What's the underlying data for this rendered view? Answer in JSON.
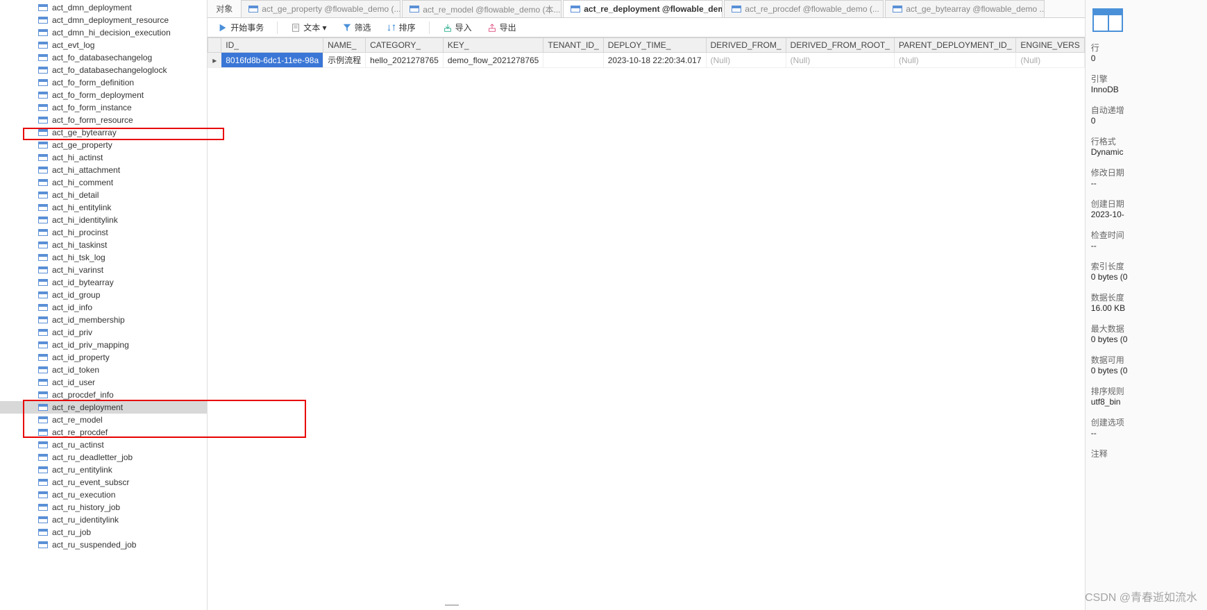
{
  "sidebar": {
    "items": [
      {
        "label": "act_dmn_deployment"
      },
      {
        "label": "act_dmn_deployment_resource"
      },
      {
        "label": "act_dmn_hi_decision_execution"
      },
      {
        "label": "act_evt_log"
      },
      {
        "label": "act_fo_databasechangelog"
      },
      {
        "label": "act_fo_databasechangeloglock"
      },
      {
        "label": "act_fo_form_definition"
      },
      {
        "label": "act_fo_form_deployment"
      },
      {
        "label": "act_fo_form_instance"
      },
      {
        "label": "act_fo_form_resource"
      },
      {
        "label": "act_ge_bytearray"
      },
      {
        "label": "act_ge_property"
      },
      {
        "label": "act_hi_actinst"
      },
      {
        "label": "act_hi_attachment"
      },
      {
        "label": "act_hi_comment"
      },
      {
        "label": "act_hi_detail"
      },
      {
        "label": "act_hi_entitylink"
      },
      {
        "label": "act_hi_identitylink"
      },
      {
        "label": "act_hi_procinst"
      },
      {
        "label": "act_hi_taskinst"
      },
      {
        "label": "act_hi_tsk_log"
      },
      {
        "label": "act_hi_varinst"
      },
      {
        "label": "act_id_bytearray"
      },
      {
        "label": "act_id_group"
      },
      {
        "label": "act_id_info"
      },
      {
        "label": "act_id_membership"
      },
      {
        "label": "act_id_priv"
      },
      {
        "label": "act_id_priv_mapping"
      },
      {
        "label": "act_id_property"
      },
      {
        "label": "act_id_token"
      },
      {
        "label": "act_id_user"
      },
      {
        "label": "act_procdef_info"
      },
      {
        "label": "act_re_deployment",
        "selected": true
      },
      {
        "label": "act_re_model"
      },
      {
        "label": "act_re_procdef"
      },
      {
        "label": "act_ru_actinst"
      },
      {
        "label": "act_ru_deadletter_job"
      },
      {
        "label": "act_ru_entitylink"
      },
      {
        "label": "act_ru_event_subscr"
      },
      {
        "label": "act_ru_execution"
      },
      {
        "label": "act_ru_history_job"
      },
      {
        "label": "act_ru_identitylink"
      },
      {
        "label": "act_ru_job"
      },
      {
        "label": "act_ru_suspended_job"
      }
    ]
  },
  "tabs": {
    "obj_label": "对象",
    "items": [
      {
        "label": "act_ge_property @flowable_demo (..."
      },
      {
        "label": "act_re_model @flowable_demo (本..."
      },
      {
        "label": "act_re_deployment @flowable_dem...",
        "active": true
      },
      {
        "label": "act_re_procdef @flowable_demo (..."
      },
      {
        "label": "act_ge_bytearray @flowable_demo ..."
      }
    ]
  },
  "toolbar": {
    "begin_tx": "开始事务",
    "text": "文本 ▾",
    "filter": "筛选",
    "sort": "排序",
    "import": "导入",
    "export": "导出"
  },
  "grid": {
    "columns": [
      "ID_",
      "NAME_",
      "CATEGORY_",
      "KEY_",
      "TENANT_ID_",
      "DEPLOY_TIME_",
      "DERIVED_FROM_",
      "DERIVED_FROM_ROOT_",
      "PARENT_DEPLOYMENT_ID_",
      "ENGINE_VERS"
    ],
    "row": {
      "id": "8016fd8b-6dc1-11ee-98a",
      "name": "示例流程",
      "category": "hello_2021278765",
      "key": "demo_flow_2021278765",
      "tenant": "",
      "deploy_time": "2023-10-18 22:20:34.017",
      "derived_from": "(Null)",
      "derived_from_root": "(Null)",
      "parent_deployment": "(Null)",
      "engine": "(Null)"
    }
  },
  "right": {
    "rows_label": "行",
    "rows_value": "0",
    "engine_label": "引擎",
    "engine_value": "InnoDB",
    "auto_label": "自动递增",
    "auto_value": "0",
    "fmt_label": "行格式",
    "fmt_value": "Dynamic",
    "mod_label": "修改日期",
    "mod_value": "--",
    "create_label": "创建日期",
    "create_value": "2023-10-",
    "check_label": "检查时间",
    "check_value": "--",
    "idxlen_label": "索引长度",
    "idxlen_value": "0 bytes (0",
    "datalen_label": "数据长度",
    "datalen_value": "16.00 KB",
    "maxlen_label": "最大数据",
    "maxlen_value": "0 bytes (0",
    "free_label": "数据可用",
    "free_value": "0 bytes (0",
    "collation_label": "排序规则",
    "collation_value": "utf8_bin",
    "opt_label": "创建选项",
    "opt_value": "--",
    "comment_label": "注释",
    "comment_value": ""
  },
  "watermark": "CSDN @青春逝如流水"
}
